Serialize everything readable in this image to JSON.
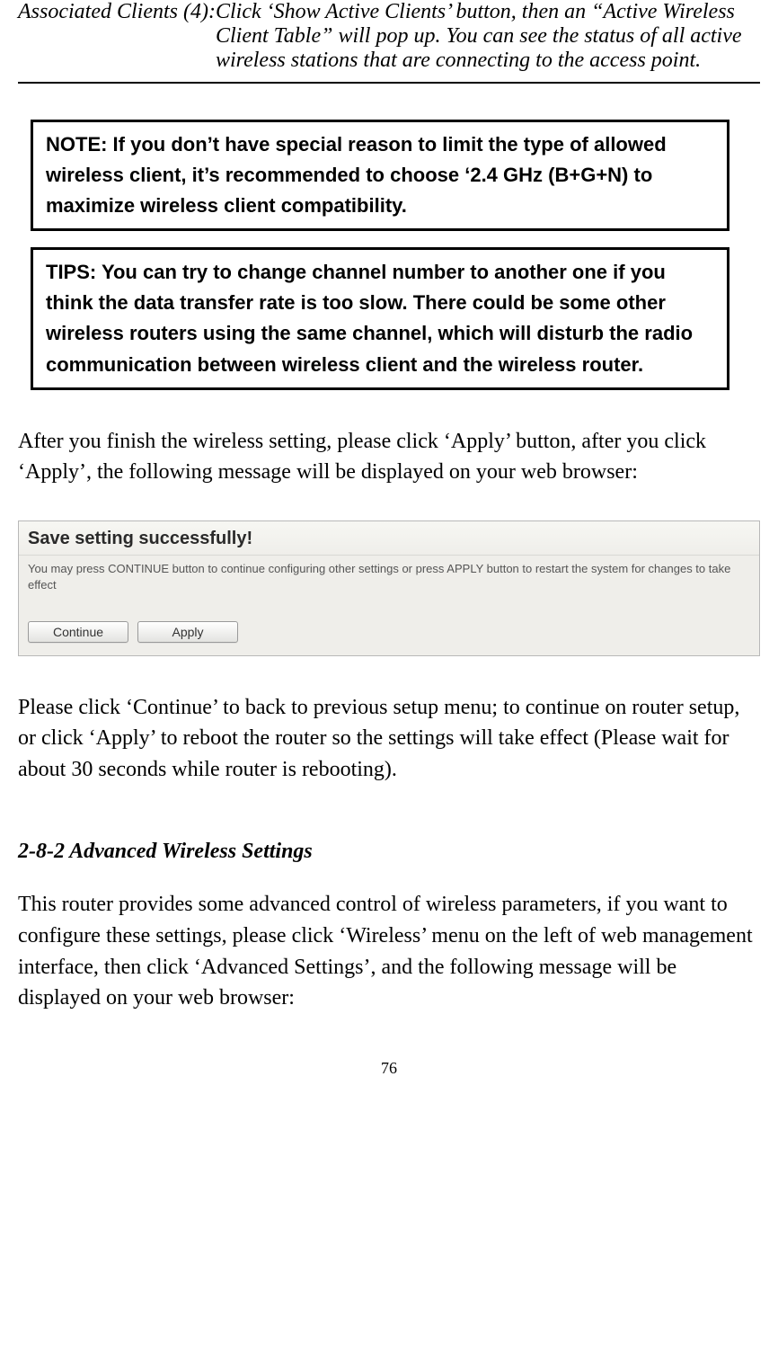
{
  "assoc": {
    "label": "Associated Clients (4): ",
    "body": "Click ‘Show Active Clients’ button, then an “Active Wireless Client Table” will pop up. You can see the status of all active wireless stations that are connecting to the access point."
  },
  "boxes": {
    "note": "NOTE: If you don’t have special reason to limit the type of allowed wireless client, it’s recommended to choose ‘2.4 GHz (B+G+N) to maximize wireless client compatibility.",
    "tips": "TIPS: You can try to change channel number to another one if you think the data transfer rate is too slow. There could be some other wireless routers using the same channel, which will disturb the radio communication between wireless client and the wireless router."
  },
  "paragraphs": {
    "after_apply": "After you finish the wireless setting, please click ‘Apply’ button, after you click ‘Apply’, the following message will be displayed on your web browser:",
    "continue_apply": "Please click ‘Continue’ to back to previous setup menu; to continue on router setup, or click ‘Apply’ to reboot the router so the settings will take effect (Please wait for about 30 seconds while router is rebooting).",
    "advanced_intro": "This router provides some advanced control of wireless parameters, if you want to configure these settings, please click ‘Wireless’ menu on the left of web management interface, then click ‘Advanced Settings’, and the following message will be displayed on your web browser:"
  },
  "screenshot": {
    "title": "Save setting successfully!",
    "desc": "You may press CONTINUE button to continue configuring other settings or press APPLY button to restart the system for changes to take effect",
    "buttons": {
      "continue": "Continue",
      "apply": "Apply"
    }
  },
  "heading": "2-8-2 Advanced Wireless Settings",
  "page_number": "76"
}
